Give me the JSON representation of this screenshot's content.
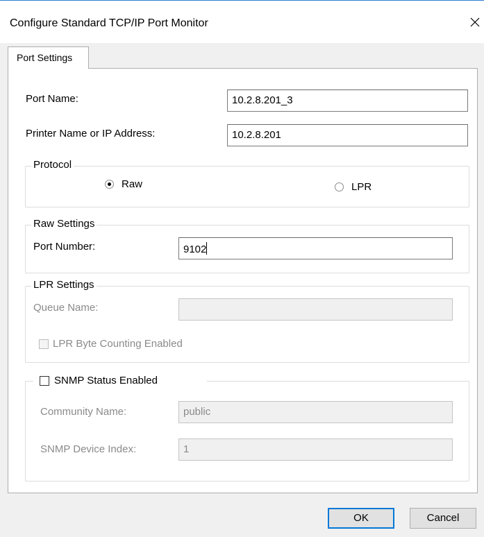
{
  "window": {
    "title": "Configure Standard TCP/IP Port Monitor"
  },
  "tabs": [
    {
      "label": "Port Settings"
    }
  ],
  "port_name": {
    "label": "Port Name:",
    "value": "10.2.8.201_3"
  },
  "printer_address": {
    "label": "Printer Name or IP Address:",
    "value": "10.2.8.201"
  },
  "protocol": {
    "legend": "Protocol",
    "options": [
      {
        "label": "Raw",
        "selected": true
      },
      {
        "label": "LPR",
        "selected": false
      }
    ]
  },
  "raw_settings": {
    "legend": "Raw Settings",
    "port_number_label": "Port Number:",
    "port_number_value": "9102"
  },
  "lpr_settings": {
    "legend": "LPR Settings",
    "queue_name_label": "Queue Name:",
    "queue_name_value": "",
    "byte_counting_label": "LPR Byte Counting Enabled",
    "byte_counting_checked": false
  },
  "snmp": {
    "enabled_label": "SNMP Status Enabled",
    "enabled_checked": false,
    "community_label": "Community Name:",
    "community_value": "public",
    "device_index_label": "SNMP Device Index:",
    "device_index_value": "1"
  },
  "buttons": {
    "ok": "OK",
    "cancel": "Cancel"
  },
  "colors": {
    "title_accent": "#2b7bd6",
    "default_button_border": "#0078d7",
    "disabled_text": "#8a8a8a"
  }
}
